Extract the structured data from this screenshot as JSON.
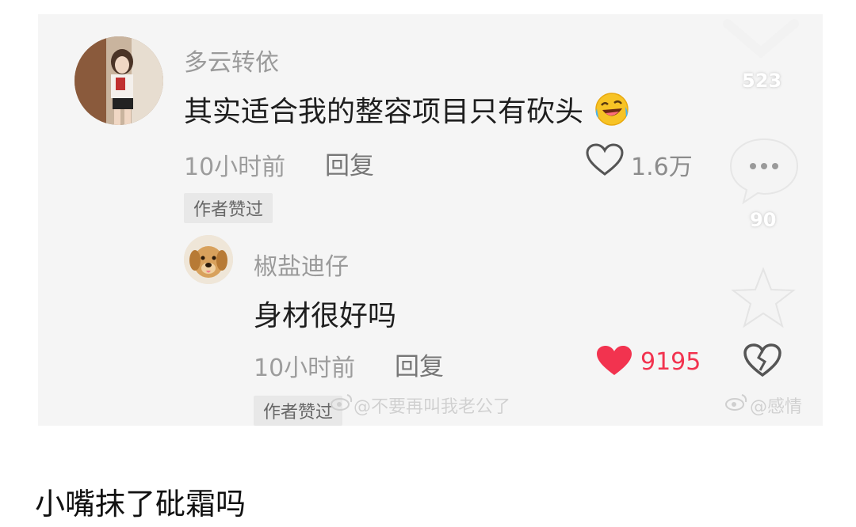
{
  "comment": {
    "username": "多云转依",
    "text": "其实适合我的整容项目只有砍头",
    "time": "10小时前",
    "reply_label": "回复",
    "likes": "1.6万",
    "author_tag": "作者赞过"
  },
  "reply": {
    "username": "椒盐迪仔",
    "text": "身材很好吗",
    "time": "10小时前",
    "reply_label": "回复",
    "likes": "9195",
    "liked": true,
    "author_tag": "作者赞过"
  },
  "side_actions": {
    "like_count": "523",
    "comment_count": "90"
  },
  "watermarks": {
    "left": "@不要再叫我老公了",
    "right": "@感情"
  },
  "caption": "小嘴抹了砒霜吗",
  "colors": {
    "like_red": "#f2334f",
    "muted_text": "#9c9c9c"
  }
}
